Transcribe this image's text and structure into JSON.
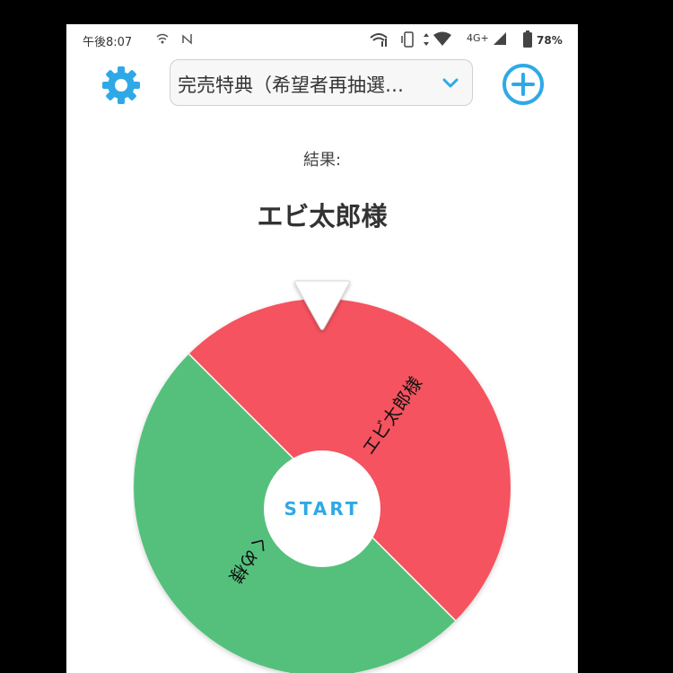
{
  "status_bar": {
    "time": "午後8:07",
    "network": "4G+",
    "battery": "78%"
  },
  "header": {
    "settings_icon": "gear-icon",
    "list_selector": "完売特典（希望者再抽選…",
    "add_icon": "plus-circle-icon"
  },
  "result": {
    "label": "結果:",
    "value": "エビ太郎様"
  },
  "wheel": {
    "start_label": "START",
    "segments": [
      {
        "label": "エビ太郎様",
        "color": "#f4535f"
      },
      {
        "label": "くめ様",
        "color": "#55c07c"
      }
    ]
  },
  "colors": {
    "accent": "#2fa9e6",
    "background": "#ffffff",
    "frame": "#000000"
  }
}
